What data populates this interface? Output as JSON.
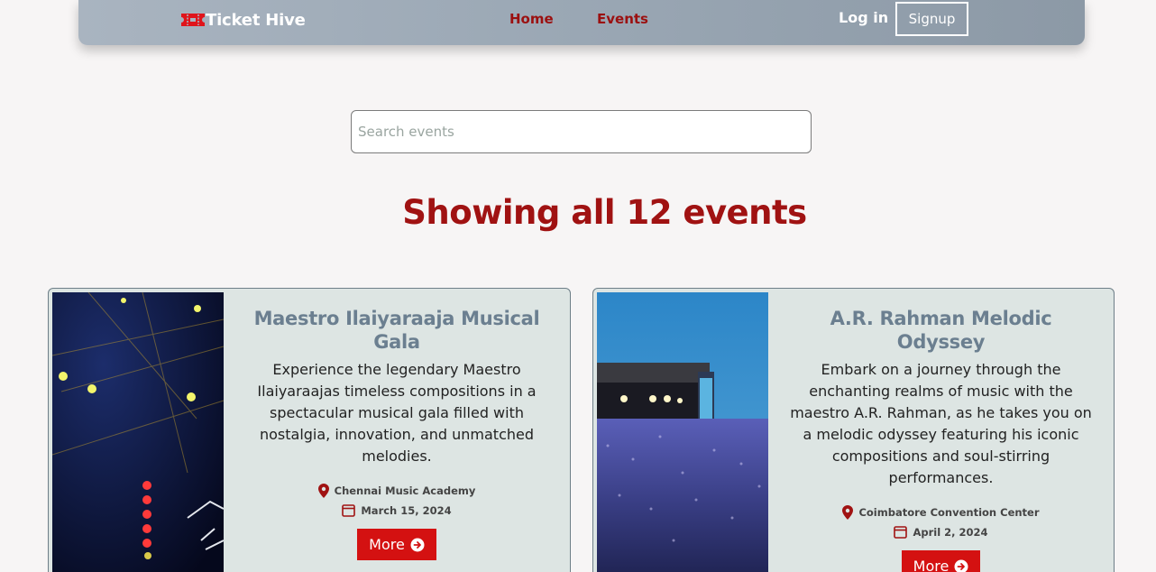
{
  "navbar": {
    "brand": "Ticket Hive",
    "links": [
      "Home",
      "Events"
    ],
    "login": "Log in",
    "signup": "Signup"
  },
  "search": {
    "placeholder": "Search events",
    "value": ""
  },
  "heading": "Showing all 12 events",
  "events": [
    {
      "title": "Maestro Ilaiyaraaja Musical Gala",
      "description": "Experience the legendary Maestro Ilaiyaraajas timeless compositions in a spectacular musical gala filled with nostalgia, innovation, and unmatched melodies.",
      "location": "Chennai Music Academy",
      "date": "March 15, 2024",
      "button": "More"
    },
    {
      "title": "A.R. Rahman Melodic Odyssey",
      "description": "Embark on a journey through the enchanting realms of music with the maestro A.R. Rahman, as he takes you on a melodic odyssey featuring his iconic compositions and soul-stirring performances.",
      "location": "Coimbatore Convention Center",
      "date": "April 2, 2024",
      "button": "More"
    }
  ],
  "colors": {
    "accent": "#d41111",
    "heading": "#a01212",
    "nav_link": "#9b1010",
    "card_bg": "#dde5e3",
    "card_title": "#6b7f90"
  },
  "icons": [
    "ticket-icon",
    "location-pin-icon",
    "calendar-icon",
    "arrow-right-circle-icon"
  ]
}
